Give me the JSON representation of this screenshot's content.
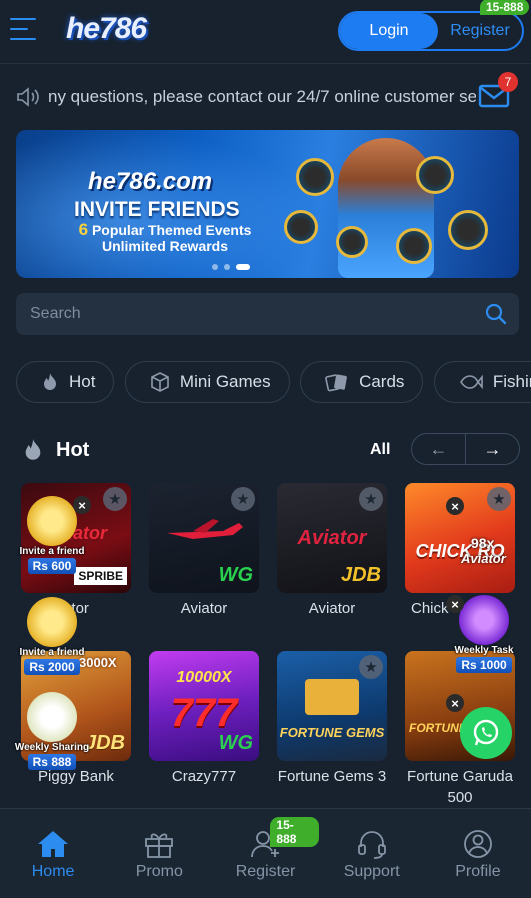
{
  "header": {
    "logo": "he786",
    "login_label": "Login",
    "register_label": "Register",
    "register_badge": "15-888"
  },
  "notice": {
    "text": "ny questions, please contact our 24/7 online customer se",
    "mail_count": "7"
  },
  "banner": {
    "logo": "he786.com",
    "title": "INVITE FRIENDS",
    "line1_number": "6",
    "line1_text": "Popular Themed Events",
    "line2": "Unlimited Rewards"
  },
  "search": {
    "placeholder": "Search"
  },
  "categories": [
    {
      "label": "Hot"
    },
    {
      "label": "Mini Games"
    },
    {
      "label": "Cards"
    },
    {
      "label": "Fishin"
    }
  ],
  "section": {
    "title": "Hot",
    "all_label": "All",
    "prev": "←",
    "next": "→"
  },
  "games_row1": [
    {
      "name": "ator",
      "tile_text": "Aviator",
      "brand": "SPRIBE"
    },
    {
      "name": "Aviator",
      "brand": "WG"
    },
    {
      "name": "Aviator",
      "tile_text": "Aviator",
      "brand": "JDB"
    },
    {
      "name": "Chick",
      "tile_text": "CHICK RO",
      "badge": "98x",
      "sub": "Aviator"
    }
  ],
  "games_row2": [
    {
      "name": "Piggy Bank",
      "tile_text": "3000X",
      "brand": "JDB"
    },
    {
      "name": "Crazy777",
      "tile_text": "10000X",
      "big": "777",
      "brand": "WG"
    },
    {
      "name": "Fortune Gems 3",
      "brand": "FORTUNE GEMS"
    },
    {
      "name": "Fortune Garuda 500",
      "brand": "FORTUNE",
      "big": "500"
    }
  ],
  "floats": {
    "invite1_label": "Invite a friend",
    "invite1_amount": "Rs 600",
    "invite2_label": "Invite a friend",
    "invite2_amount": "Rs 2000",
    "weekly_sharing_label": "Weekly Sharing",
    "weekly_sharing_amount": "Rs 888",
    "weekly_task_label": "Weekly Task",
    "weekly_task_amount": "Rs 1000"
  },
  "bottom_nav": [
    {
      "label": "Home"
    },
    {
      "label": "Promo"
    },
    {
      "label": "Register",
      "badge": "15-888"
    },
    {
      "label": "Support"
    },
    {
      "label": "Profile"
    }
  ],
  "colors": {
    "background": "#17222e",
    "accent": "#1e7cf2",
    "badge_green": "#3fae2a",
    "badge_red": "#e0322e"
  }
}
